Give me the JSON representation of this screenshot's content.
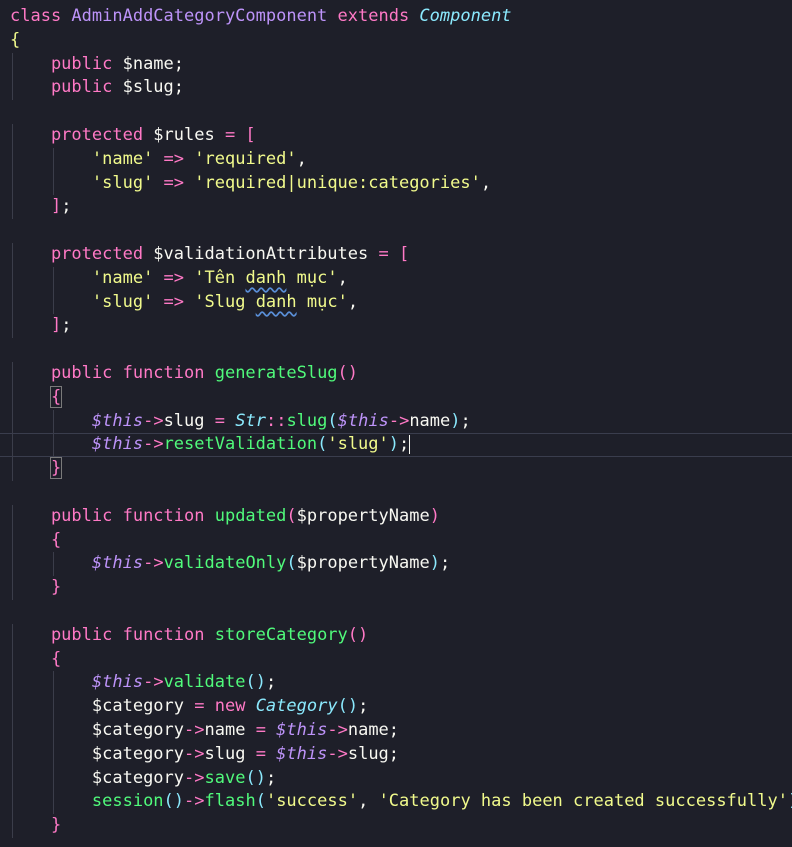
{
  "editor": {
    "lines": [
      [
        {
          "t": "class ",
          "c": "kw"
        },
        {
          "t": "AdminAddCategoryComponent",
          "c": "cls"
        },
        {
          "t": " extends ",
          "c": "kw"
        },
        {
          "t": "Component",
          "c": "type"
        }
      ],
      [
        {
          "t": "{",
          "c": "brace-y"
        }
      ],
      [
        {
          "t": "    public ",
          "c": "kw"
        },
        {
          "t": "$name;",
          "c": "var"
        }
      ],
      [
        {
          "t": "    public ",
          "c": "kw"
        },
        {
          "t": "$slug;",
          "c": "var"
        }
      ],
      [],
      [
        {
          "t": "    protected ",
          "c": "kw"
        },
        {
          "t": "$rules ",
          "c": "var"
        },
        {
          "t": "= [",
          "c": "op"
        }
      ],
      [
        {
          "t": "        ",
          "c": "plain"
        },
        {
          "t": "'name'",
          "c": "str"
        },
        {
          "t": " => ",
          "c": "op"
        },
        {
          "t": "'required'",
          "c": "str"
        },
        {
          "t": ",",
          "c": "plain"
        }
      ],
      [
        {
          "t": "        ",
          "c": "plain"
        },
        {
          "t": "'slug'",
          "c": "str"
        },
        {
          "t": " => ",
          "c": "op"
        },
        {
          "t": "'required|unique:categories'",
          "c": "str"
        },
        {
          "t": ",",
          "c": "plain"
        }
      ],
      [
        {
          "t": "    ]",
          "c": "op"
        },
        {
          "t": ";",
          "c": "plain"
        }
      ],
      [],
      [
        {
          "t": "    protected ",
          "c": "kw"
        },
        {
          "t": "$validationAttributes ",
          "c": "var"
        },
        {
          "t": "= [",
          "c": "op"
        }
      ],
      [
        {
          "t": "        ",
          "c": "plain"
        },
        {
          "t": "'name'",
          "c": "str"
        },
        {
          "t": " => ",
          "c": "op"
        },
        {
          "t": "'Tên ",
          "c": "str"
        },
        {
          "t": "danh",
          "c": "str squig"
        },
        {
          "t": " mục'",
          "c": "str"
        },
        {
          "t": ",",
          "c": "plain"
        }
      ],
      [
        {
          "t": "        ",
          "c": "plain"
        },
        {
          "t": "'slug'",
          "c": "str"
        },
        {
          "t": " => ",
          "c": "op"
        },
        {
          "t": "'Slug ",
          "c": "str"
        },
        {
          "t": "danh",
          "c": "str squig"
        },
        {
          "t": " mục'",
          "c": "str"
        },
        {
          "t": ",",
          "c": "plain"
        }
      ],
      [
        {
          "t": "    ]",
          "c": "op"
        },
        {
          "t": ";",
          "c": "plain"
        }
      ],
      [],
      [
        {
          "t": "    public ",
          "c": "kw"
        },
        {
          "t": "function ",
          "c": "kw"
        },
        {
          "t": "generateSlug",
          "c": "fn"
        },
        {
          "t": "()",
          "c": "brace-p"
        }
      ],
      [
        {
          "t": "    ",
          "c": "plain"
        },
        {
          "t": "{",
          "c": "brace-p bracket-box"
        }
      ],
      [
        {
          "t": "        ",
          "c": "plain"
        },
        {
          "t": "$this",
          "c": "this"
        },
        {
          "t": "->",
          "c": "op"
        },
        {
          "t": "slug ",
          "c": "plain"
        },
        {
          "t": "= ",
          "c": "op"
        },
        {
          "t": "Str",
          "c": "type"
        },
        {
          "t": "::",
          "c": "op"
        },
        {
          "t": "slug",
          "c": "fn"
        },
        {
          "t": "(",
          "c": "brace-b"
        },
        {
          "t": "$this",
          "c": "this"
        },
        {
          "t": "->",
          "c": "op"
        },
        {
          "t": "name",
          "c": "plain"
        },
        {
          "t": ")",
          "c": "brace-b"
        },
        {
          "t": ";",
          "c": "plain"
        }
      ],
      [
        {
          "t": "        ",
          "c": "plain"
        },
        {
          "t": "$this",
          "c": "this"
        },
        {
          "t": "->",
          "c": "op"
        },
        {
          "t": "resetValidation",
          "c": "fn"
        },
        {
          "t": "(",
          "c": "brace-b"
        },
        {
          "t": "'slug'",
          "c": "str"
        },
        {
          "t": ")",
          "c": "brace-b"
        },
        {
          "t": ";",
          "c": "plain"
        }
      ],
      [
        {
          "t": "    ",
          "c": "plain"
        },
        {
          "t": "}",
          "c": "brace-p bracket-box"
        }
      ],
      [],
      [
        {
          "t": "    public ",
          "c": "kw"
        },
        {
          "t": "function ",
          "c": "kw"
        },
        {
          "t": "updated",
          "c": "fn"
        },
        {
          "t": "(",
          "c": "brace-p"
        },
        {
          "t": "$propertyName",
          "c": "var"
        },
        {
          "t": ")",
          "c": "brace-p"
        }
      ],
      [
        {
          "t": "    {",
          "c": "brace-p"
        }
      ],
      [
        {
          "t": "        ",
          "c": "plain"
        },
        {
          "t": "$this",
          "c": "this"
        },
        {
          "t": "->",
          "c": "op"
        },
        {
          "t": "validateOnly",
          "c": "fn"
        },
        {
          "t": "(",
          "c": "brace-b"
        },
        {
          "t": "$propertyName",
          "c": "var"
        },
        {
          "t": ")",
          "c": "brace-b"
        },
        {
          "t": ";",
          "c": "plain"
        }
      ],
      [
        {
          "t": "    }",
          "c": "brace-p"
        }
      ],
      [],
      [
        {
          "t": "    public ",
          "c": "kw"
        },
        {
          "t": "function ",
          "c": "kw"
        },
        {
          "t": "storeCategory",
          "c": "fn"
        },
        {
          "t": "()",
          "c": "brace-p"
        }
      ],
      [
        {
          "t": "    {",
          "c": "brace-p"
        }
      ],
      [
        {
          "t": "        ",
          "c": "plain"
        },
        {
          "t": "$this",
          "c": "this"
        },
        {
          "t": "->",
          "c": "op"
        },
        {
          "t": "validate",
          "c": "fn"
        },
        {
          "t": "()",
          "c": "brace-b"
        },
        {
          "t": ";",
          "c": "plain"
        }
      ],
      [
        {
          "t": "        ",
          "c": "plain"
        },
        {
          "t": "$category ",
          "c": "var"
        },
        {
          "t": "= ",
          "c": "op"
        },
        {
          "t": "new ",
          "c": "kw"
        },
        {
          "t": "Category",
          "c": "type"
        },
        {
          "t": "()",
          "c": "brace-b"
        },
        {
          "t": ";",
          "c": "plain"
        }
      ],
      [
        {
          "t": "        ",
          "c": "plain"
        },
        {
          "t": "$category",
          "c": "var"
        },
        {
          "t": "->",
          "c": "op"
        },
        {
          "t": "name ",
          "c": "plain"
        },
        {
          "t": "= ",
          "c": "op"
        },
        {
          "t": "$this",
          "c": "this"
        },
        {
          "t": "->",
          "c": "op"
        },
        {
          "t": "name",
          "c": "plain"
        },
        {
          "t": ";",
          "c": "plain"
        }
      ],
      [
        {
          "t": "        ",
          "c": "plain"
        },
        {
          "t": "$category",
          "c": "var"
        },
        {
          "t": "->",
          "c": "op"
        },
        {
          "t": "slug ",
          "c": "plain"
        },
        {
          "t": "= ",
          "c": "op"
        },
        {
          "t": "$this",
          "c": "this"
        },
        {
          "t": "->",
          "c": "op"
        },
        {
          "t": "slug",
          "c": "plain"
        },
        {
          "t": ";",
          "c": "plain"
        }
      ],
      [
        {
          "t": "        ",
          "c": "plain"
        },
        {
          "t": "$category",
          "c": "var"
        },
        {
          "t": "->",
          "c": "op"
        },
        {
          "t": "save",
          "c": "fn"
        },
        {
          "t": "()",
          "c": "brace-b"
        },
        {
          "t": ";",
          "c": "plain"
        }
      ],
      [
        {
          "t": "        ",
          "c": "plain"
        },
        {
          "t": "session",
          "c": "fn"
        },
        {
          "t": "()",
          "c": "brace-b"
        },
        {
          "t": "->",
          "c": "op"
        },
        {
          "t": "flash",
          "c": "fn"
        },
        {
          "t": "(",
          "c": "brace-b"
        },
        {
          "t": "'success'",
          "c": "str"
        },
        {
          "t": ", ",
          "c": "plain"
        },
        {
          "t": "'Category has been created successfully'",
          "c": "str"
        },
        {
          "t": ")",
          "c": "brace-b"
        },
        {
          "t": ";",
          "c": "plain"
        }
      ],
      [
        {
          "t": "    }",
          "c": "brace-p"
        }
      ]
    ],
    "active_line": 18
  }
}
